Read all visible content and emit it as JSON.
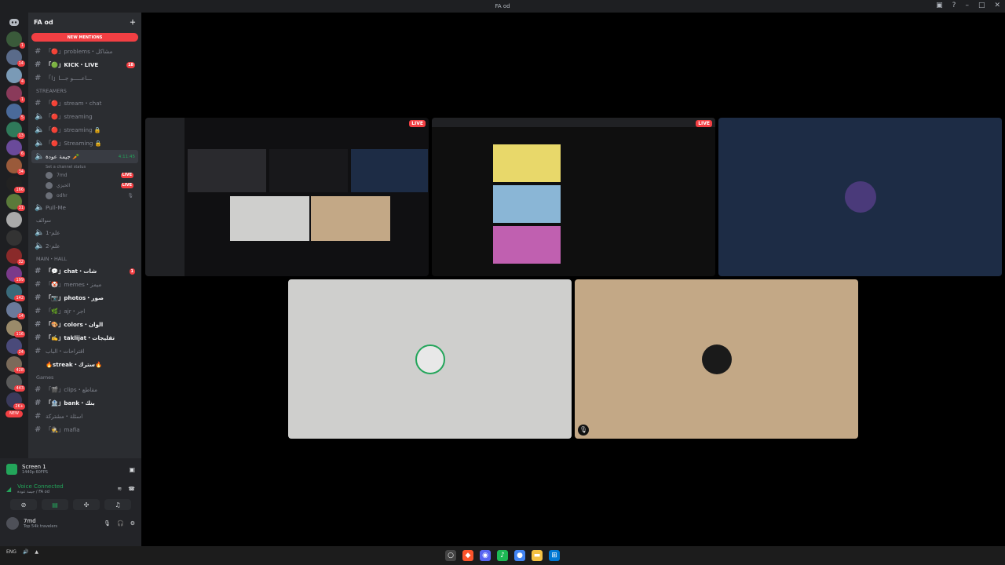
{
  "window": {
    "title": "FA od"
  },
  "guild": {
    "name": "FA od",
    "new_mentions": "NEW MENTIONS"
  },
  "channels": {
    "problems": "「🔴」problems・مشاكل",
    "kick": "「🟢」KICK・LIVE",
    "kick_badge": "18",
    "arabic1": "「ا」ـــاعـــــو جـــا",
    "streamers_cat": "STREAMERS",
    "stream_chat": "「🔴」stream・chat",
    "streaming1": "「🔴」streaming",
    "streaming2": "「🔴」streaming 🔒",
    "streaming3": "「🔴」Streaming 🔒",
    "voice_active": "جيمة عودة 🥕",
    "voice_status": "Set a channel status",
    "voice_time": "4:11:45",
    "members": [
      {
        "name": "7md",
        "live": "LIVE"
      },
      {
        "name": "الحيزي",
        "live": "LIVE"
      },
      {
        "name": "odhr",
        "live": ""
      }
    ],
    "pull_me": "Pull-Me",
    "cat2": "سوالف",
    "v1": "علم-1",
    "v2": "علم-2",
    "main_cat": "MAIN・HALL",
    "chat": "「💬」chat・شات",
    "chat_badge": "1",
    "memes": "「🤡」memes・ميمز",
    "photos": "「📷」photos・صور",
    "ajr": "「🌿」ajr・اجر",
    "colors": "「🎨」colors・الوان",
    "taklijat": "「✍️」taklijat・تقليجات",
    "aliab": "اقتراحات・الباب",
    "streak": "🔥streak・سترك🔥",
    "games_cat": "Games",
    "clips": "「🎬」clips・مقاطع",
    "bank": "「🏦」bank・بنك",
    "q": "اسئلة・مشتركة",
    "mafia": "「🕵」mafia"
  },
  "servers": {
    "new": "NEW",
    "badges": [
      "1",
      "14",
      "4",
      "1",
      "5",
      "13",
      "6",
      "34",
      "166",
      "31",
      "32",
      "199",
      "142",
      "14",
      "116",
      "24",
      "428",
      "443",
      "2K+"
    ]
  },
  "screen": {
    "title": "Screen 1",
    "sub": "1440p 60FPS"
  },
  "voice": {
    "connected": "Voice Connected",
    "channel": "جيمة عودة / FA od"
  },
  "user": {
    "name": "7md",
    "status": "Top 54k travelers"
  },
  "tiles": {
    "live1": "LIVE",
    "live2": "LIVE"
  },
  "taskbar": {
    "lang": "ENG"
  },
  "colors": {
    "bg": "#000000",
    "sidebar": "#2b2d31",
    "server_rail": "#1e1f22",
    "live": "#f23f43",
    "green": "#23a55a",
    "tile_grey": "#cfcfcd",
    "tile_tan": "#c3a886",
    "tile_navy": "#1d2c45"
  }
}
